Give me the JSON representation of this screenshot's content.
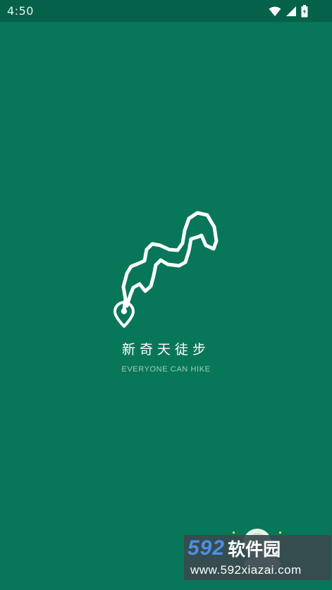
{
  "status_bar": {
    "time": "4:50"
  },
  "splash": {
    "app_name": "新奇天徒步",
    "slogan": "EVERYONE CAN HIKE"
  },
  "watermark": {
    "brand_number": "592",
    "brand_text": "软件园",
    "url": "www.592xiazai.com"
  },
  "icons": {
    "wifi": "wifi-icon",
    "signal": "cell-signal-icon",
    "battery": "battery-icon",
    "logo": "hiking-trail-logo-icon"
  },
  "colors": {
    "background": "#087759",
    "status_bar": "#06614a",
    "slogan": "#9fcdbd",
    "watermark_number": "#4d8fe6"
  }
}
